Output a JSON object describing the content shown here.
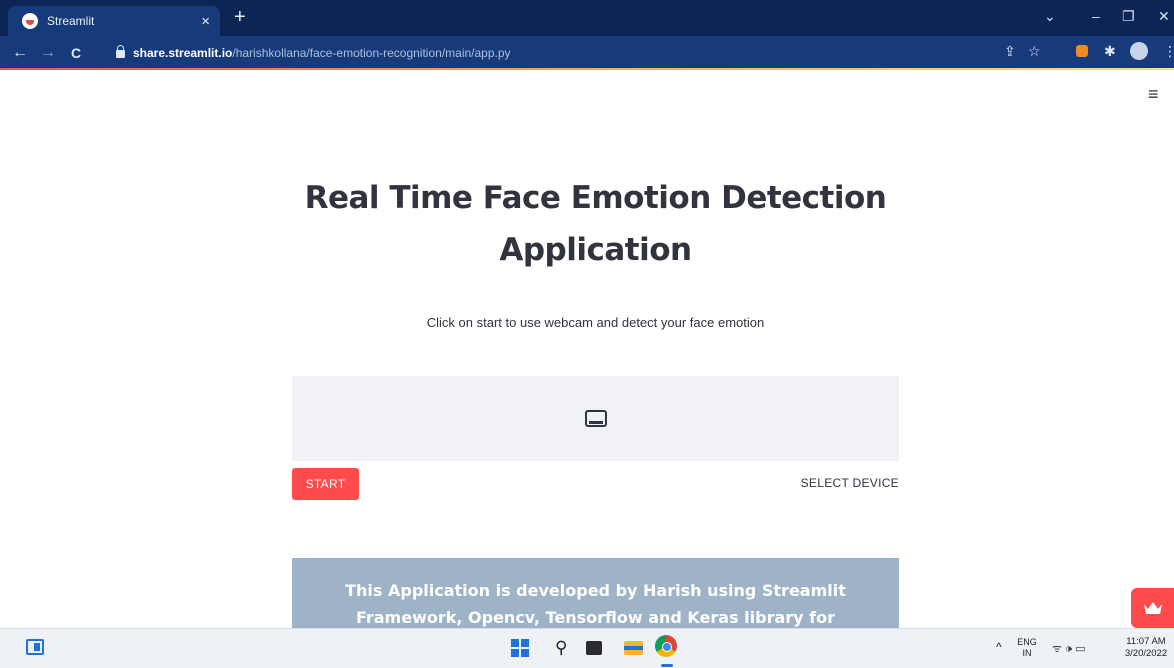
{
  "browser": {
    "tab_title": "Streamlit",
    "tab_close": "×",
    "new_tab": "+",
    "url_host": "share.streamlit.io",
    "url_path": "/harishkollana/face-emotion-recognition/main/app.py",
    "nav": {
      "back": "←",
      "forward": "→",
      "reload": "C"
    },
    "window_controls": {
      "list": "⌄",
      "minimize": "–",
      "restore": "❐",
      "close": "✕"
    },
    "toolbar_icons": {
      "share": "⇪",
      "bookmark": "☆",
      "extension": "✱",
      "menu": "⋮"
    }
  },
  "page": {
    "menu_icon": "≡",
    "title": "Real Time Face Emotion Detection Application",
    "subtitle": "Click on start to use webcam and detect your face emotion",
    "start_label": "START",
    "select_device_label": "SELECT DEVICE",
    "info_text": "This Application is developed by Harish using Streamlit Framework, Opencv, Tensorflow and Keras library for"
  },
  "taskbar": {
    "search_glyph": "⚲",
    "tray_chevron": "^",
    "lang_line1": "ENG",
    "lang_line2": "IN",
    "tray_icons": "ᯤ  🕩  ▭",
    "time": "11:07 AM",
    "date": "3/20/2022"
  },
  "colors": {
    "accent": "#ff4b4b",
    "chrome_dark": "#0d2554",
    "chrome_toolbar": "#173b7a",
    "text": "#31333f",
    "info_bg": "#9fb3c8",
    "video_bg": "#f0f2f6"
  }
}
